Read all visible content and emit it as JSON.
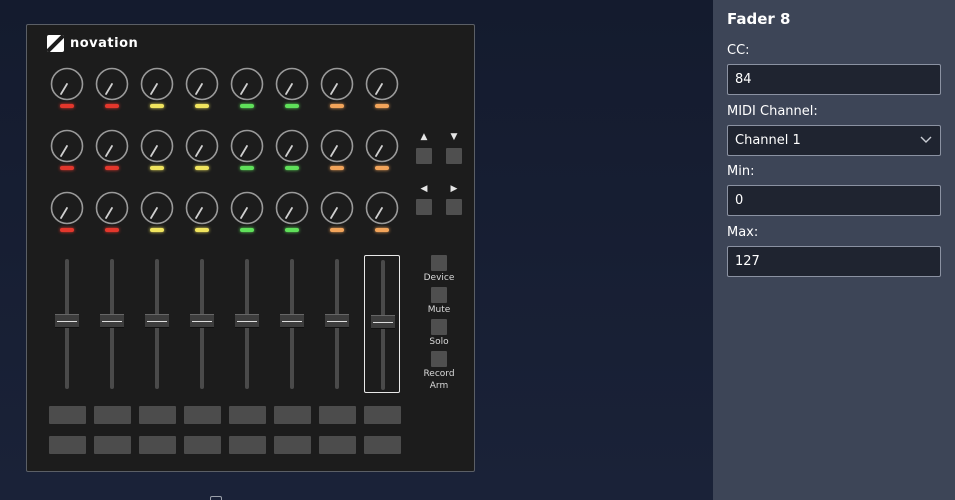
{
  "device": {
    "logo_text": "novation",
    "knob_rows": [
      [
        "red",
        "red",
        "yellow",
        "yellow",
        "green",
        "green",
        "orange",
        "orange"
      ],
      [
        "red",
        "red",
        "yellow",
        "yellow",
        "green",
        "green",
        "orange",
        "orange"
      ],
      [
        "red",
        "red",
        "yellow",
        "yellow",
        "green",
        "green",
        "orange",
        "orange"
      ]
    ],
    "fader_count": 8,
    "selected_fader": 8,
    "arrows": {
      "up": "▲",
      "down": "▼",
      "left": "◀",
      "right": "▶"
    },
    "side_buttons": [
      "Device",
      "Mute",
      "Solo",
      "Record\nArm"
    ]
  },
  "panel": {
    "title": "Fader 8",
    "cc_label": "CC:",
    "cc_value": "84",
    "channel_label": "MIDI Channel:",
    "channel_value": "Channel 1",
    "min_label": "Min:",
    "min_value": "0",
    "max_label": "Max:",
    "max_value": "127"
  },
  "colors": {
    "background": "#141b2e",
    "panel": "#3d4557",
    "device": "#1c1c1c"
  }
}
